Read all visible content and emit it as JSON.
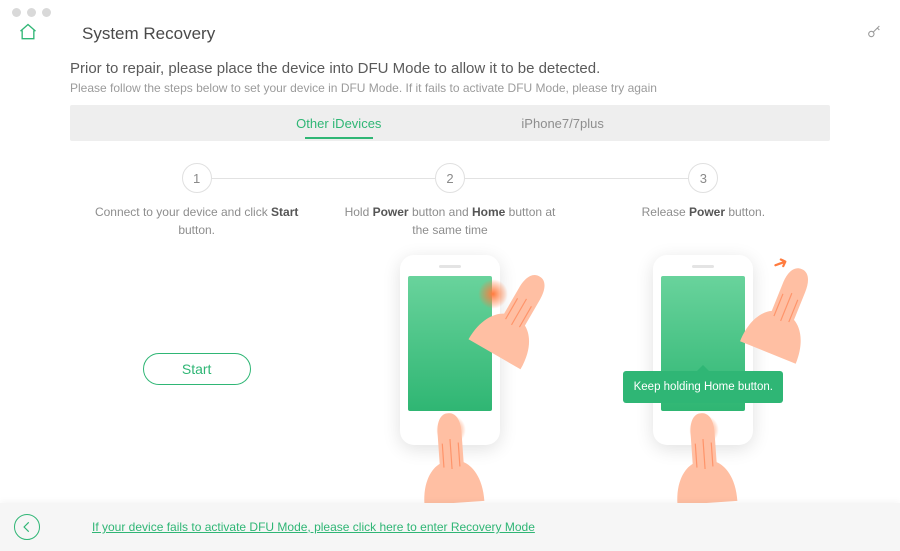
{
  "app": {
    "title": "System Recovery"
  },
  "header": {
    "heading": "Prior to repair, please place the device into DFU Mode to allow it to be detected.",
    "subheading": "Please follow the steps below to set your device in DFU Mode. If it fails to activate DFU Mode, please try again"
  },
  "tabs": {
    "active": "Other iDevices",
    "other": "iPhone7/7plus"
  },
  "steps": {
    "s1": {
      "num": "1",
      "pre": "Connect to your device and click ",
      "bold": "Start",
      "post": " button."
    },
    "s2": {
      "num": "2",
      "pre": "Hold ",
      "b1": "Power",
      "mid": " button and ",
      "b2": "Home",
      "post": " button at the same time"
    },
    "s3": {
      "num": "3",
      "pre": "Release ",
      "bold": "Power",
      "post": " button."
    }
  },
  "start_label": "Start",
  "tooltip": "Keep holding Home button.",
  "footer_link": "If your device fails to activate DFU Mode, please click here to enter Recovery Mode",
  "colors": {
    "accent": "#2fb675"
  }
}
